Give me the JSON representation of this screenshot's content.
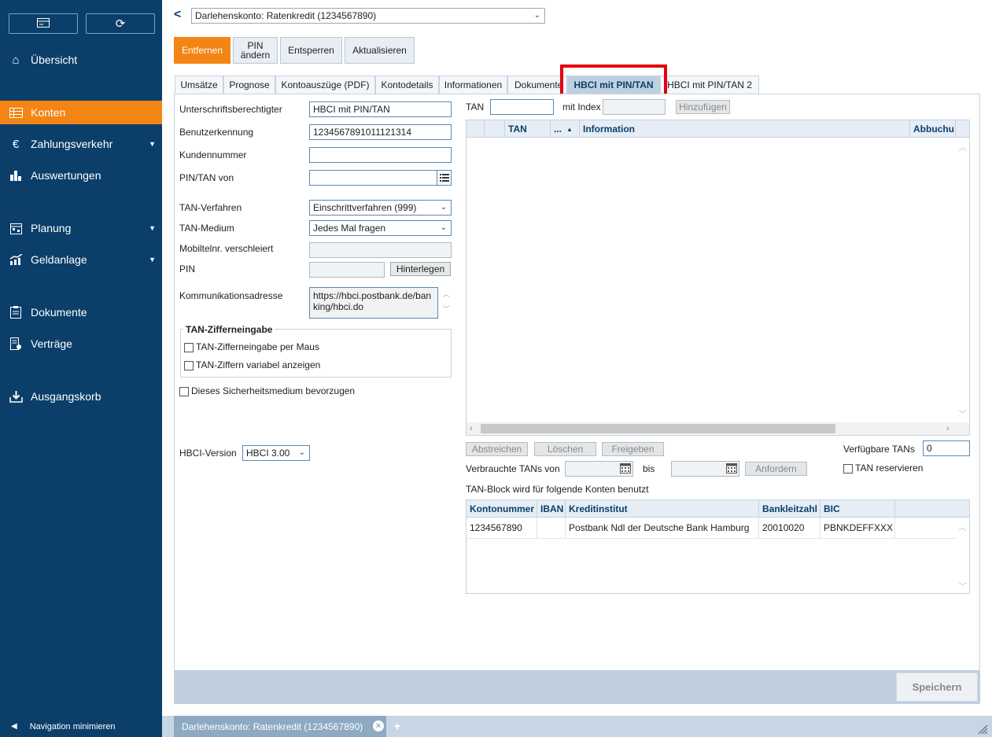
{
  "sidebar": {
    "items": [
      {
        "label": "Übersicht"
      },
      {
        "label": "Konten"
      },
      {
        "label": "Zahlungsverkehr"
      },
      {
        "label": "Auswertungen"
      },
      {
        "label": "Planung"
      },
      {
        "label": "Geldanlage"
      },
      {
        "label": "Dokumente"
      },
      {
        "label": "Verträge"
      },
      {
        "label": "Ausgangskorb"
      }
    ],
    "minimize_label": "Navigation minimieren"
  },
  "header": {
    "account_select": "Darlehenskonto: Ratenkredit (1234567890)"
  },
  "toolbar": {
    "remove": "Entfernen",
    "pin_line1": "PIN",
    "pin_line2": "ändern",
    "unlock": "Entsperren",
    "refresh": "Aktualisieren"
  },
  "tabs": [
    "Umsätze",
    "Prognose",
    "Kontoauszüge (PDF)",
    "Kontodetails",
    "Informationen",
    "Dokumente",
    "HBCI mit PIN/TAN",
    "HBCI mit PIN/TAN 2"
  ],
  "form": {
    "signatory_label": "Unterschriftsberechtigter",
    "signatory_value": "HBCI mit PIN/TAN",
    "user_id_label": "Benutzerkennung",
    "user_id_value": "1234567891011121314",
    "customer_no_label": "Kundennummer",
    "customer_no_value": "",
    "pintan_from_label": "PIN/TAN von",
    "pintan_from_value": "",
    "tan_method_label": "TAN-Verfahren",
    "tan_method_value": "Einschrittverfahren (999)",
    "tan_medium_label": "TAN-Medium",
    "tan_medium_value": "Jedes Mal fragen",
    "mobile_label": "Mobiltelnr. verschleiert",
    "pin_label": "PIN",
    "store_button": "Hinterlegen",
    "comm_address_label": "Kommunikationsadresse",
    "comm_address_line1": "https://hbci.postbank.de/ban",
    "comm_address_line2": "king/hbci.do",
    "tan_digits_group": "TAN-Zifferneingabe",
    "tan_digits_mouse": "TAN-Zifferneingabe per Maus",
    "tan_digits_variable": "TAN-Ziffern variabel anzeigen",
    "prefer_medium": "Dieses Sicherheitsmedium bevorzugen",
    "hbci_version_label": "HBCI-Version",
    "hbci_version_value": "HBCI 3.00"
  },
  "tan_panel": {
    "tan_label": "TAN",
    "index_label": "mit Index",
    "add_button": "Hinzufügen",
    "columns": [
      "TAN",
      "...",
      "Information",
      "Abbuchu"
    ],
    "strike_button": "Abstreichen",
    "delete_button": "Löschen",
    "release_button": "Freigeben",
    "available_label": "Verfügbare TANs",
    "available_value": "0",
    "used_from_label": "Verbrauchte TANs von",
    "to_label": "bis",
    "request_button": "Anfordern",
    "reserve_label": "TAN reservieren",
    "used_for_label": "TAN-Block wird für folgende Konten benutzt"
  },
  "accounts_table": {
    "columns": [
      "Kontonummer",
      "IBAN",
      "Kreditinstitut",
      "Bankleitzahl",
      "BIC"
    ],
    "rows": [
      [
        "1234567890",
        "",
        "Postbank Ndl der Deutsche Bank Hamburg",
        "20010020",
        "PBNKDEFFXXX"
      ]
    ]
  },
  "footer": {
    "save_button": "Speichern"
  },
  "bottom_tabs": {
    "open_tab": "Darlehenskonto: Ratenkredit (1234567890)",
    "add": "+"
  },
  "colors": {
    "sidebar_bg": "#0b3f6a",
    "accent": "#f28513",
    "highlight_box": "#e3000f"
  }
}
